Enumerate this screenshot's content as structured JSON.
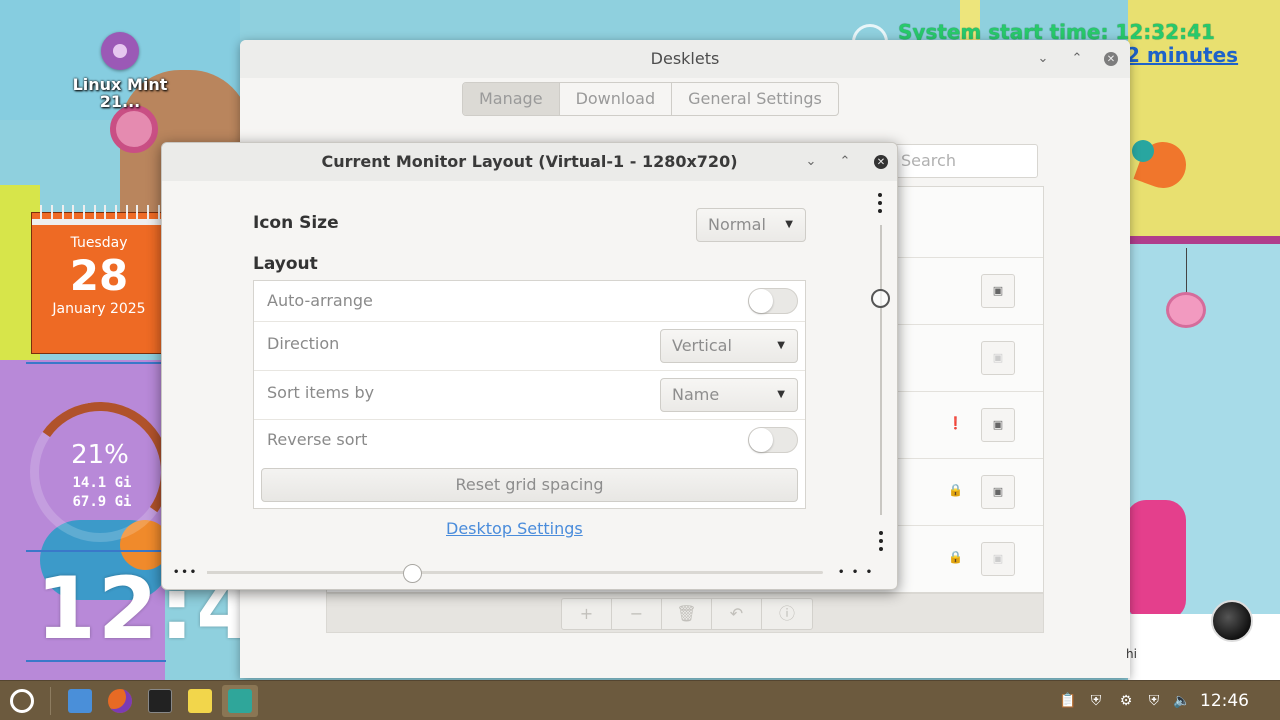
{
  "desktop": {
    "icon_label": "Linux Mint 21...",
    "calendar": {
      "weekday": "Tuesday",
      "day": "28",
      "month_year": "January 2025"
    },
    "memory": {
      "percent": "21%",
      "used": "14.1 Gi",
      "total": "67.9 Gi"
    },
    "big_clock": "12:4",
    "uptime": {
      "line1": "System start time: 12:32:41",
      "line2": "2 minutes"
    },
    "partial_text": "hi"
  },
  "desklets_window": {
    "title": "Desklets",
    "tabs": [
      {
        "label": "Manage",
        "active": true
      },
      {
        "label": "Download",
        "active": false
      },
      {
        "label": "General Settings",
        "active": false
      }
    ],
    "search_placeholder": "Search",
    "toolbar_buttons": [
      "+",
      "−",
      "🗑",
      "↶",
      "ⓘ"
    ]
  },
  "dialog": {
    "title": "Current Monitor Layout (Virtual-1 - 1280x720)",
    "icon_size_label": "Icon Size",
    "icon_size_value": "Normal",
    "layout_label": "Layout",
    "rows": {
      "auto_arrange": {
        "label": "Auto-arrange",
        "checked": false
      },
      "direction": {
        "label": "Direction",
        "value": "Vertical"
      },
      "sort_by": {
        "label": "Sort items by",
        "value": "Name"
      },
      "reverse_sort": {
        "label": "Reverse sort",
        "checked": false
      }
    },
    "reset_button": "Reset grid spacing",
    "desktop_settings_link": "Desktop Settings",
    "zoom_slider_value": 0.33
  },
  "taskbar": {
    "clock": "12:46",
    "apps": [
      "menu-icon",
      "files-icon",
      "firefox-icon",
      "terminal-icon",
      "notes-icon",
      "desklets-icon"
    ]
  },
  "colors": {
    "uptime_green": "#27c96b",
    "uptime_blue": "#1e62c9",
    "calendar_orange": "#ee6a24",
    "taskbar": "#6c5a3e",
    "link_blue": "#4a8cdb"
  }
}
